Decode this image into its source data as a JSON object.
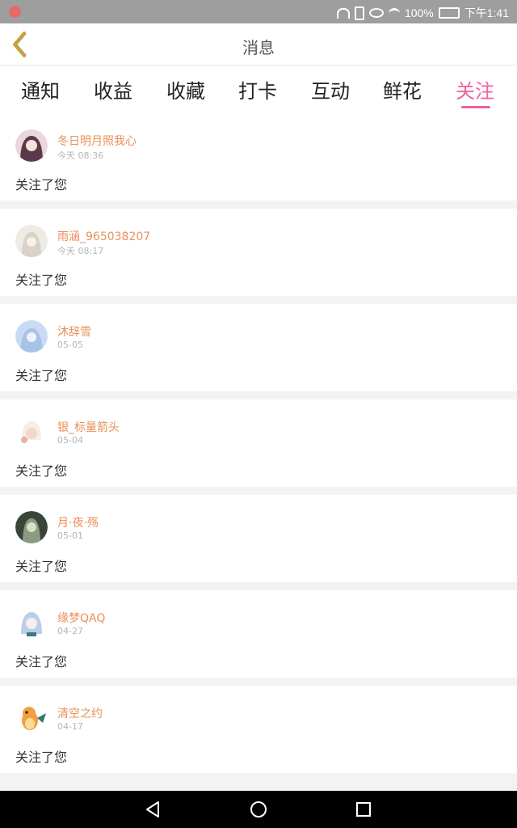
{
  "status_bar": {
    "battery": "100%",
    "time": "下午1:41"
  },
  "header": {
    "title": "消息",
    "back_icon": "chevron-left-icon",
    "accent_color": "#c8a23c"
  },
  "tabs": [
    {
      "label": "通知",
      "active": false
    },
    {
      "label": "收益",
      "active": false
    },
    {
      "label": "收藏",
      "active": false
    },
    {
      "label": "打卡",
      "active": false
    },
    {
      "label": "互动",
      "active": false
    },
    {
      "label": "鲜花",
      "active": false
    },
    {
      "label": "关注",
      "active": true
    }
  ],
  "colors": {
    "active_tab": "#f05fa0",
    "username": "#e8915a",
    "timestamp": "#b5b5b5"
  },
  "messages": [
    {
      "username": "冬日明月照我心",
      "time": "今天 08:36",
      "action": "关注了您",
      "avatar_color": "#5a3a4a"
    },
    {
      "username": "雨涵_965038207",
      "time": "今天 08:17",
      "action": "关注了您",
      "avatar_color": "#d8d2c8"
    },
    {
      "username": "沐辞雪",
      "time": "05-05",
      "action": "关注了您",
      "avatar_color": "#a9c3e6"
    },
    {
      "username": "银_标量箭头",
      "time": "05-04",
      "action": "关注了您",
      "avatar_color": "#e8b0a6"
    },
    {
      "username": "月·夜·殇",
      "time": "05-01",
      "action": "关注了您",
      "avatar_color": "#4b5a48"
    },
    {
      "username": "缘梦QAQ",
      "time": "04-27",
      "action": "关注了您",
      "avatar_color": "#b9cfe8"
    },
    {
      "username": "清空之约",
      "time": "04-17",
      "action": "关注了您",
      "avatar_color": "#f0a040"
    }
  ],
  "nav_bar": {
    "back_icon": "triangle-back-icon",
    "home_icon": "circle-home-icon",
    "recents_icon": "square-recents-icon"
  }
}
